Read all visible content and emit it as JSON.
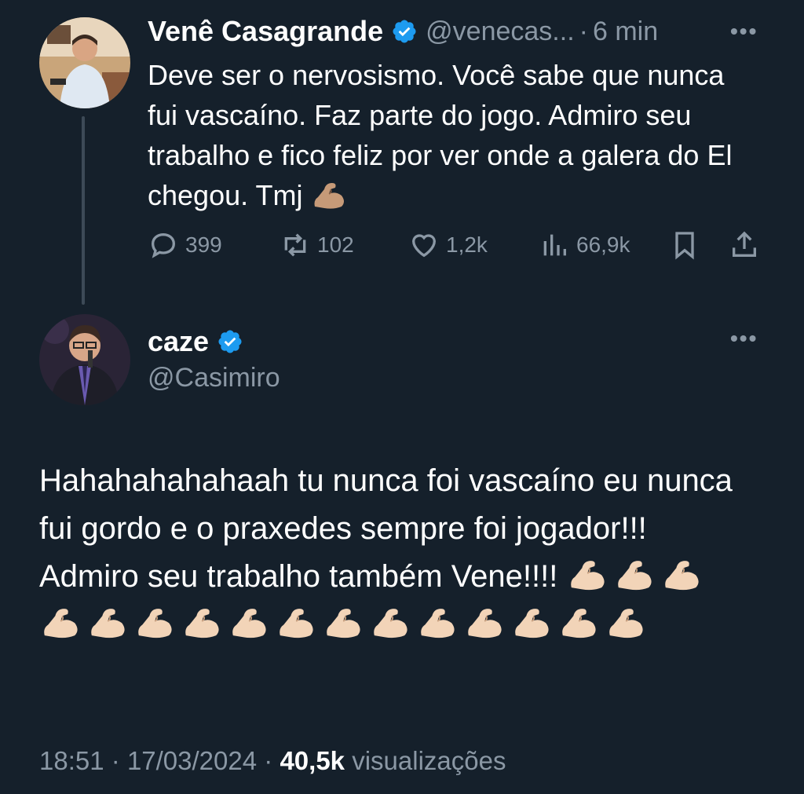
{
  "colors": {
    "background": "#15202b",
    "text": "#ffffff",
    "muted": "#8b98a5",
    "verified": "#1d9bf0",
    "thread_line": "#3d4a57"
  },
  "tweet1": {
    "author_name": "Venê Casagrande",
    "handle": "@venecas...",
    "separator": "·",
    "time": "6 min",
    "more": "•••",
    "text": "Deve ser o nervosismo. Você sabe que nunca fui vascaíno. Faz parte do jogo. Admiro seu trabalho e fico feliz por ver onde a galera do El chegou. Tmj",
    "emoji": "flexed-biceps",
    "actions": {
      "replies": "399",
      "retweets": "102",
      "likes": "1,2k",
      "views": "66,9k"
    },
    "icons": [
      "reply-icon",
      "retweet-icon",
      "like-icon",
      "views-icon",
      "bookmark-icon",
      "share-icon"
    ]
  },
  "tweet2": {
    "author_name": "caze",
    "handle": "@Casimiro",
    "more": "•••",
    "text": "Hahahahahahaah tu nunca foi vascaíno eu nunca fui gordo e o praxedes sempre foi jogador!!! Admiro seu trabalho também Vene!!!!",
    "emoji": "flexed-biceps",
    "emoji_count": 16,
    "footer": {
      "time": "18:51",
      "sep1": "·",
      "date": "17/03/2024",
      "sep2": "·",
      "views_count": "40,5k",
      "views_label": "visualizações"
    }
  }
}
